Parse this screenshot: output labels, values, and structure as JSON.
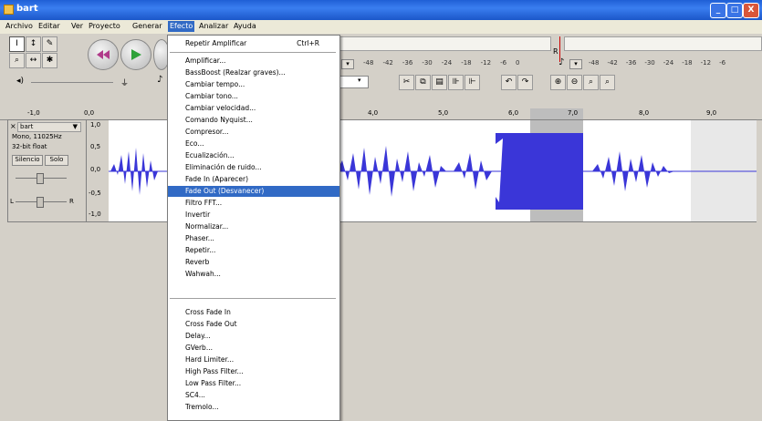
{
  "window": {
    "title": "bart",
    "min": "_",
    "max": "□",
    "close": "X"
  },
  "menubar": [
    "Archivo",
    "Editar",
    "Ver",
    "Proyecto",
    "Generar",
    "Efecto",
    "Analizar",
    "Ayuda"
  ],
  "meters": {
    "output_label": "R",
    "scale_left": [
      "-48",
      "-42",
      "-36",
      "-30",
      "-24",
      "-18",
      "-12",
      "-6",
      "0"
    ],
    "scale_right": [
      "-48",
      "-42",
      "-36",
      "-30",
      "-24",
      "-18",
      "-12",
      "-6"
    ]
  },
  "ruler": [
    "-1,0",
    "0,0",
    "4,0",
    "5,0",
    "6,0",
    "7,0",
    "8,0",
    "9,0"
  ],
  "track": {
    "name": "bart",
    "info1": "Mono, 11025Hz",
    "info2": "32-bit float",
    "mute": "Silencio",
    "solo": "Solo",
    "pan_left": "L",
    "pan_right": "R",
    "scale": [
      "1,0",
      "0,5",
      "0,0",
      "-0,5",
      "-1,0"
    ]
  },
  "effect_menu": {
    "items": [
      {
        "label": "Repetir Amplificar",
        "shortcut": "Ctrl+R"
      },
      {
        "label": "Amplificar..."
      },
      {
        "label": "BassBoost (Realzar graves)..."
      },
      {
        "label": "Cambiar tempo..."
      },
      {
        "label": "Cambiar tono..."
      },
      {
        "label": "Cambiar velocidad..."
      },
      {
        "label": "Comando Nyquist..."
      },
      {
        "label": "Compresor..."
      },
      {
        "label": "Eco..."
      },
      {
        "label": "Ecualización..."
      },
      {
        "label": "Eliminación de ruido..."
      },
      {
        "label": "Fade In (Aparecer)"
      },
      {
        "label": "Fade Out (Desvanecer)"
      },
      {
        "label": "Filtro FFT..."
      },
      {
        "label": "Invertir"
      },
      {
        "label": "Normalizar..."
      },
      {
        "label": "Phaser..."
      },
      {
        "label": "Repetir..."
      },
      {
        "label": "Reverb"
      },
      {
        "label": "Wahwah..."
      },
      {
        "label": "Cross Fade In"
      },
      {
        "label": "Cross Fade Out"
      },
      {
        "label": "Delay..."
      },
      {
        "label": "GVerb..."
      },
      {
        "label": "Hard Limiter..."
      },
      {
        "label": "High Pass Filter..."
      },
      {
        "label": "Low Pass Filter..."
      },
      {
        "label": "SC4..."
      },
      {
        "label": "Tremolo..."
      }
    ],
    "highlighted": "Fade Out (Desvanecer)"
  },
  "colors": {
    "titlebar": "#2a63d8",
    "highlight": "#316ac5",
    "wave": "#3a36d8",
    "wave_selected": "#3a36d8"
  }
}
